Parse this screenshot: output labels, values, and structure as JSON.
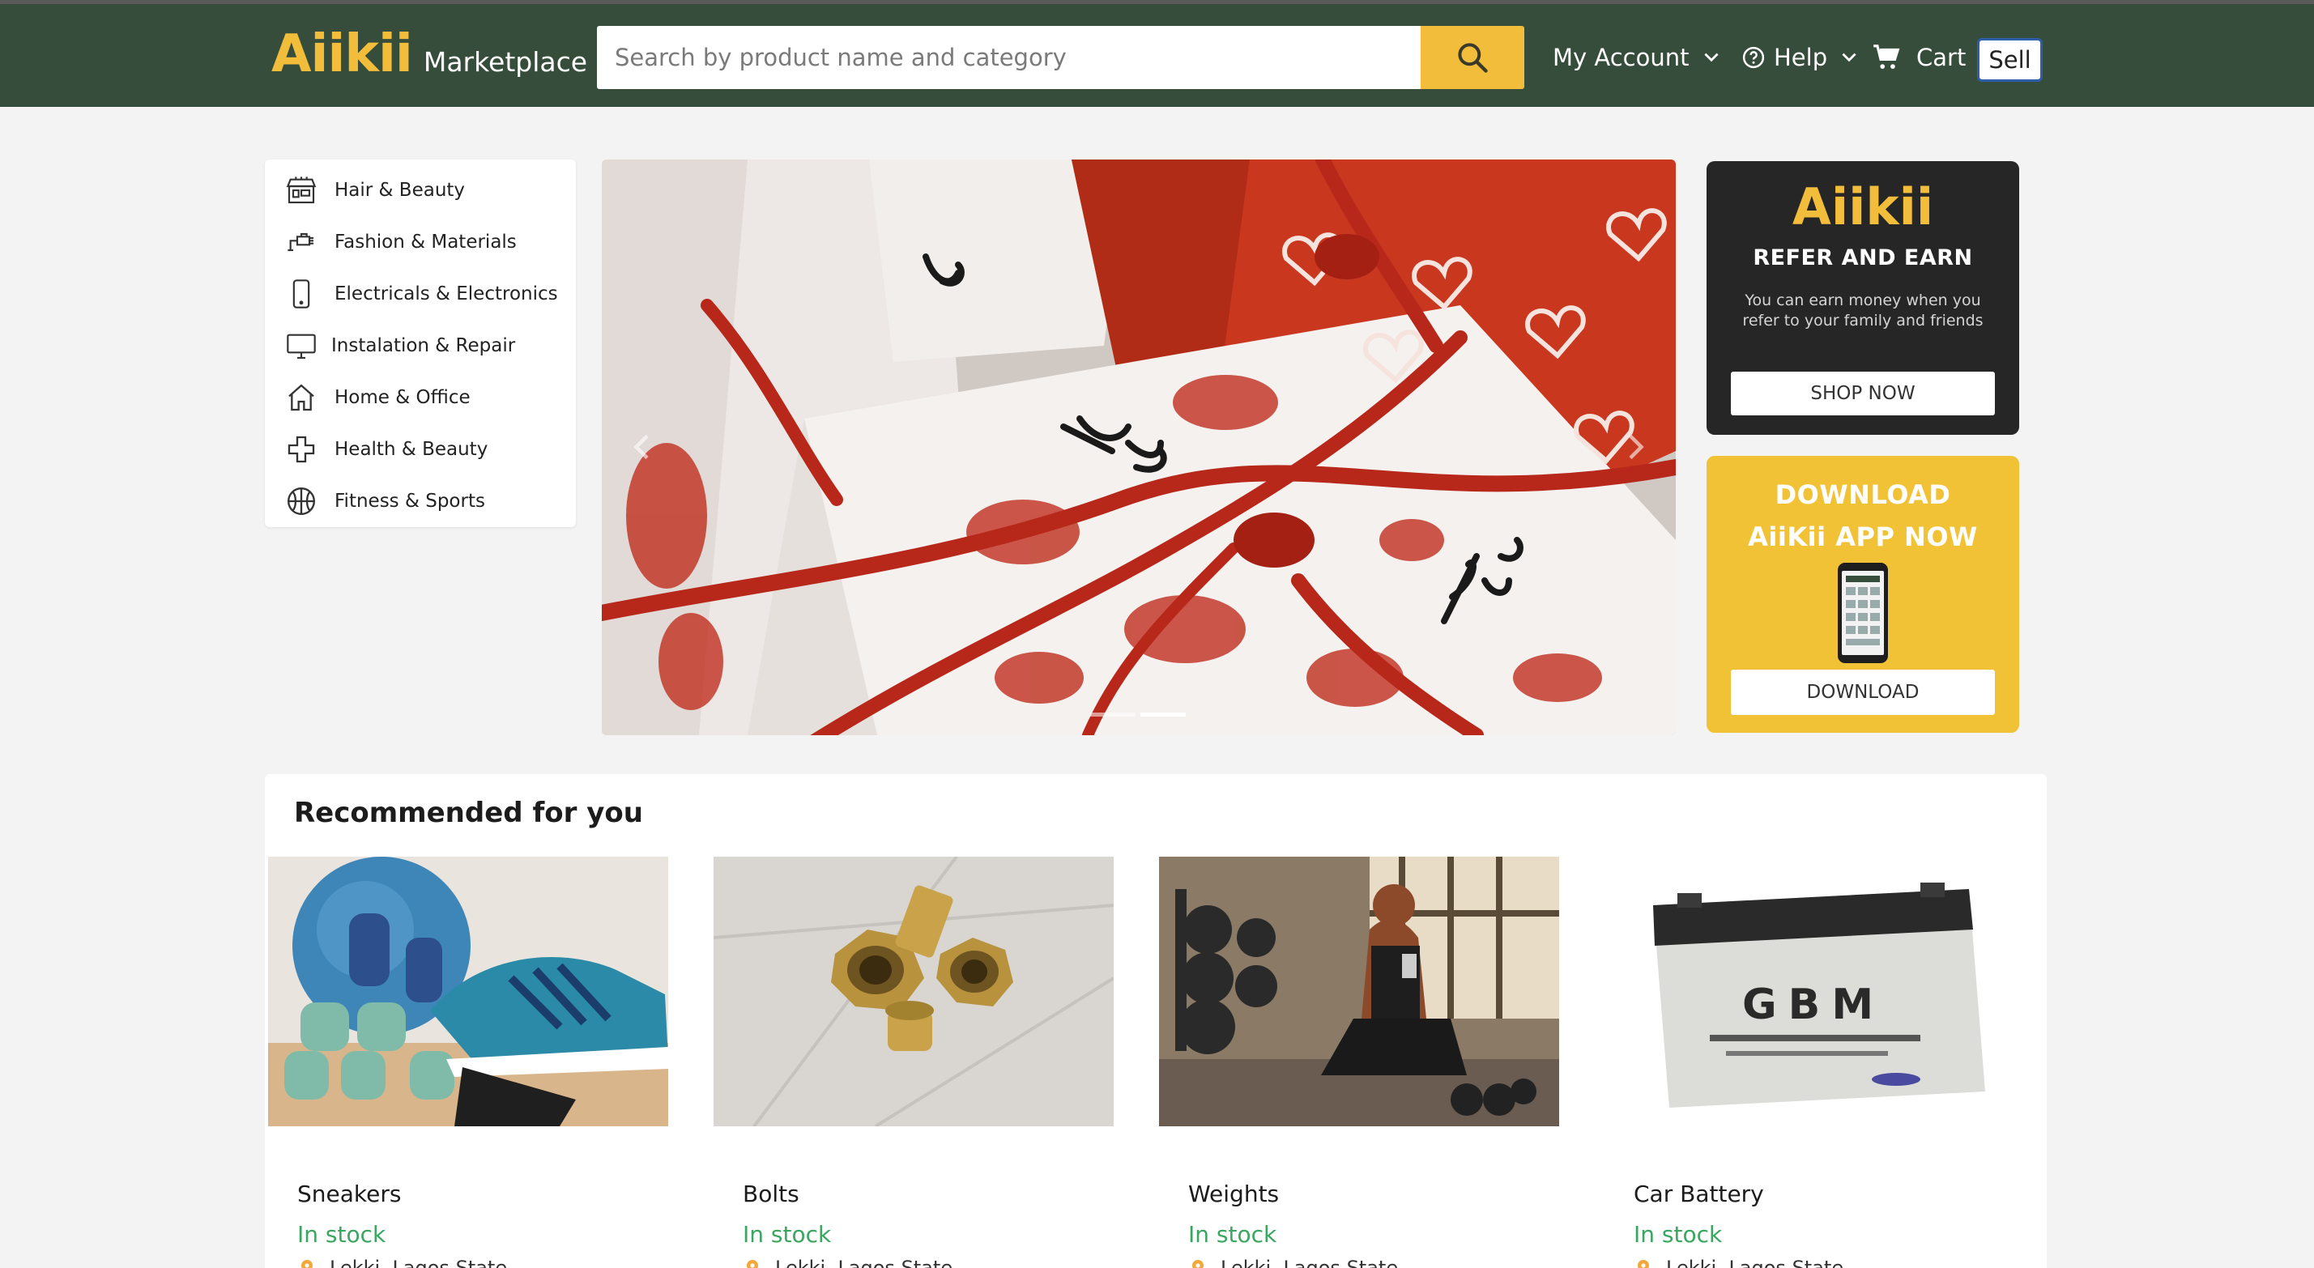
{
  "header": {
    "logo_mark": "Aiikii",
    "logo_sub": "Marketplace",
    "search_placeholder": "Search by product name and category",
    "my_account": "My Account",
    "help": "Help",
    "cart": "Cart",
    "sell": "Sell"
  },
  "categories": [
    {
      "label": "Hair & Beauty",
      "icon": "store-icon"
    },
    {
      "label": "Fashion & Materials",
      "icon": "hairdryer-icon"
    },
    {
      "label": "Electricals & Electronics",
      "icon": "phone-icon"
    },
    {
      "label": "Instalation & Repair",
      "icon": "monitor-icon"
    },
    {
      "label": "Home & Office",
      "icon": "home-icon"
    },
    {
      "label": "Health & Beauty",
      "icon": "plus-icon"
    },
    {
      "label": "Fitness & Sports",
      "icon": "basketball-icon"
    }
  ],
  "hero": {
    "slide_count": 2,
    "active_slide": 1
  },
  "refer_card": {
    "logo": "Aiikii",
    "title": "REFER AND EARN",
    "text": "You can earn money when you refer to your family and friends",
    "button": "SHOP NOW"
  },
  "download_card": {
    "title_line1": "DOWNLOAD",
    "title_line2": "AiiKii APP NOW",
    "button": "DOWNLOAD"
  },
  "recommended": {
    "title": "Recommended for you",
    "products": [
      {
        "name": "Sneakers",
        "stock": "In stock",
        "location": "Lekki, Lagos State"
      },
      {
        "name": "Bolts",
        "stock": "In stock",
        "location": "Lekki, Lagos State"
      },
      {
        "name": "Weights",
        "stock": "In stock",
        "location": "Lekki, Lagos State"
      },
      {
        "name": "Car Battery",
        "stock": "In stock",
        "location": "Lekki, Lagos State"
      }
    ]
  },
  "colors": {
    "header_bg": "#354d3a",
    "accent_yellow": "#f2bd3a",
    "stock_green": "#3aa65f",
    "pin_orange": "#f2a93a"
  }
}
